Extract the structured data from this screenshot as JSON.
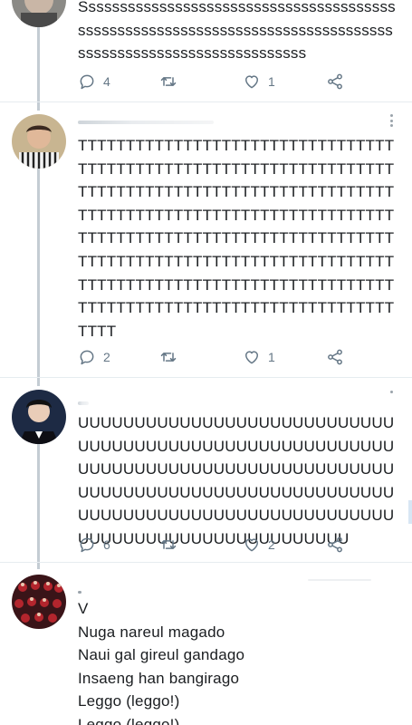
{
  "tweets": [
    {
      "avatar": "avatar-gray-portrait",
      "text": "Sssssssssssssssssssssssssssssssssssssssssssssssssssssssssssssssssssssssssssssssssssssssssssssssssssssssssssss",
      "actions": {
        "reply_count": "4",
        "retweet_count": "",
        "like_count": "1"
      }
    },
    {
      "avatar": "avatar-striped-shirt",
      "text": "TTTTTTTTTTTTTTTTTTTTTTTTTTTTTTTTTTTTTTTTTTTTTTTTTTTTTTTTTTTTTTTTTTTTTTTTTTTTTTTTTTTTTTTTTTTTTTTTTTTTTTTTTTTTTTTTTTTTTTTTTTTTTTTTTTTTTTTTTTTTTTTTTTTTTTTTTTTTTTTTTTTTTTTTTTTTTTTTTTTTTTTTTTTTTTTTTTTTTTTTTTTTTTTTTTTTTTTTTTTTTTTTTTTTTTTTTTTTTTTTTTTTTTTTTTTTTTTTTTTTTTTTTTTT",
      "actions": {
        "reply_count": "2",
        "retweet_count": "",
        "like_count": "1"
      }
    },
    {
      "avatar": "avatar-suit-portrait",
      "text": "UUUUUUUUUUUUUUUUUUUUUUUUUUUUUUUUUUUUUUUUUUUUUUUUUUUUUUUUUUUUUUUUUUUUUUUUUUUUUUUUUUUUUUUUUUUUUUUUUUUUUUUUUUUUUUUUUUUUUUUUUUUUUUUUUUUUUUUUUUUUUUUUUUUUUUUUUUUUUUUUUUUU",
      "actions": {
        "reply_count": "6",
        "retweet_count": "",
        "like_count": "2"
      }
    },
    {
      "avatar": "avatar-group-red",
      "lines": [
        "V",
        "Nuga nareul magado",
        "Naui gal gireul gandago",
        "Insaeng han bangirago",
        "Leggo (leggo!)",
        "Leggo (leggo!)"
      ]
    }
  ],
  "icons": {
    "reply": "reply-icon",
    "retweet": "retweet-icon",
    "like": "heart-icon",
    "share": "share-icon",
    "more": "more-options-icon"
  },
  "colors": {
    "action_gray": "#657786",
    "thread_line": "#c4ccd3",
    "divider": "#e6ecf0"
  }
}
